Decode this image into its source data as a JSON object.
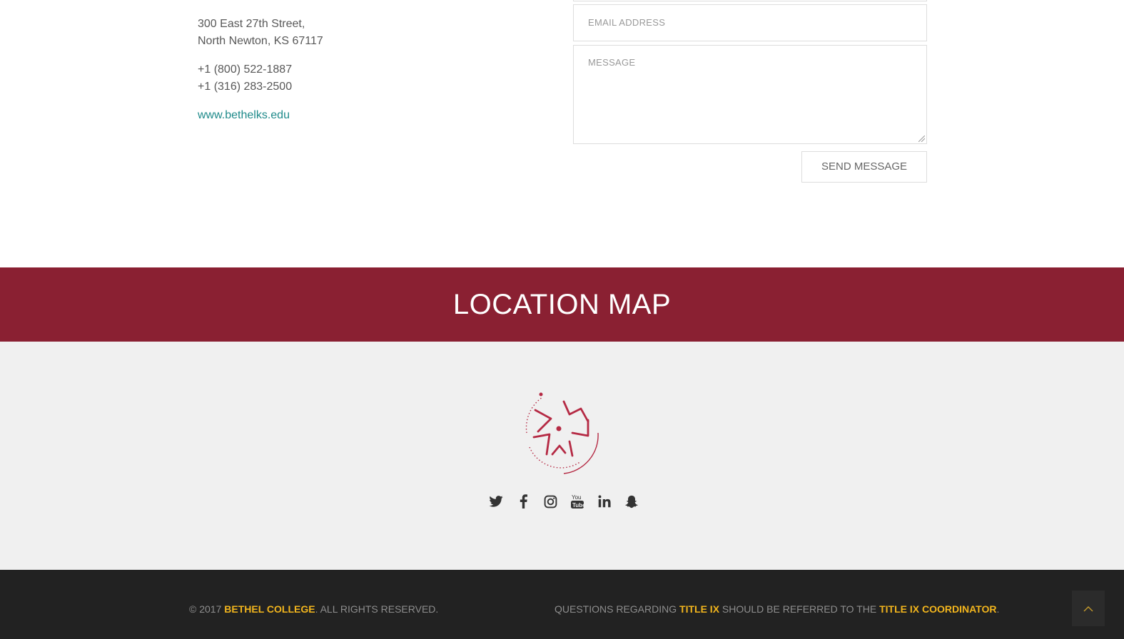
{
  "contact": {
    "address_line1": "300 East 27th Street,",
    "address_line2": "North Newton, KS 67117",
    "phone1": "+1 (800) 522-1887",
    "phone2": "+1 (316) 283-2500",
    "website": "www.bethelks.edu"
  },
  "form": {
    "email_placeholder": "EMAIL ADDRESS",
    "message_placeholder": "MESSAGE",
    "send_label": "SEND MESSAGE"
  },
  "map_section": {
    "title": "LOCATION MAP",
    "banner_color": "#8a2032"
  },
  "social": {
    "icons": [
      "twitter-icon",
      "facebook-icon",
      "instagram-icon",
      "youtube-icon",
      "linkedin-icon",
      "snapchat-icon"
    ]
  },
  "footer": {
    "copyright_prefix": "© 2017 ",
    "college_name": "BETHEL COLLEGE",
    "rights": ". ALL RIGHTS RESERVED.",
    "questions_prefix": "QUESTIONS REGARDING ",
    "title_ix": "TITLE IX",
    "referred": " SHOULD BE REFERRED TO THE ",
    "coordinator": "TITLE IX COORDINATOR",
    "period": ".",
    "accent_color": "#f2b51d"
  }
}
